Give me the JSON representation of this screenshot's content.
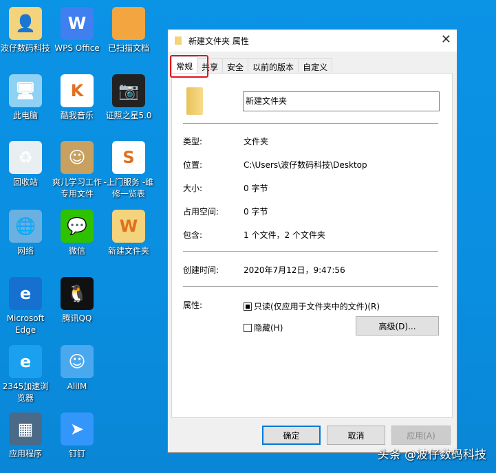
{
  "desktop": {
    "icons": [
      {
        "label": "波仔数码科技",
        "icon": "user-folder-icon",
        "color": "#f3d37b",
        "glyph": "👤"
      },
      {
        "label": "WPS Office",
        "icon": "wps-icon",
        "color": "#3f7ff0",
        "glyph": "W"
      },
      {
        "label": "已扫描文档",
        "icon": "folder-icon",
        "color": "#f3a640",
        "glyph": ""
      },
      {
        "label": "此电脑",
        "icon": "computer-icon",
        "color": "#8fd0f5",
        "glyph": "🖥"
      },
      {
        "label": "酷我音乐",
        "icon": "kuwo-icon",
        "color": "#ffffff",
        "glyph": "K"
      },
      {
        "label": "证照之星5.0",
        "icon": "camera-icon",
        "color": "#222222",
        "glyph": "📷"
      },
      {
        "label": "回收站",
        "icon": "recycle-bin-icon",
        "color": "#e8eef2",
        "glyph": "♻"
      },
      {
        "label": "爽儿学习工作专用文件",
        "icon": "photo-icon",
        "color": "#c8a060",
        "glyph": "☺"
      },
      {
        "label": "-上门服务 -维修一览表",
        "icon": "spreadsheet-icon",
        "color": "#ffffff",
        "glyph": "S"
      },
      {
        "label": "网络",
        "icon": "network-icon",
        "color": "#6ab0e0",
        "glyph": "🌐"
      },
      {
        "label": "微信",
        "icon": "wechat-icon",
        "color": "#2dc100",
        "glyph": "💬"
      },
      {
        "label": "新建文件夹",
        "icon": "folder-icon",
        "color": "#f3d37b",
        "glyph": "W"
      },
      {
        "label": "Microsoft Edge",
        "icon": "edge-icon",
        "color": "#1570d0",
        "glyph": "e"
      },
      {
        "label": "腾讯QQ",
        "icon": "qq-icon",
        "color": "#111111",
        "glyph": "🐧"
      },
      {
        "label": "",
        "icon": "",
        "color": "",
        "glyph": ""
      },
      {
        "label": "2345加速浏览器",
        "icon": "browser-icon",
        "color": "#1aa0ef",
        "glyph": "e"
      },
      {
        "label": "AliIM",
        "icon": "aliim-icon",
        "color": "#4aa8ef",
        "glyph": "☺"
      },
      {
        "label": "",
        "icon": "",
        "color": "",
        "glyph": ""
      },
      {
        "label": "应用程序",
        "icon": "apps-icon",
        "color": "#4a6a88",
        "glyph": "▦"
      },
      {
        "label": "钉钉",
        "icon": "dingtalk-icon",
        "color": "#3296fa",
        "glyph": "➤"
      }
    ]
  },
  "dialog": {
    "title": "新建文件夹 属性",
    "tabs": [
      "常规",
      "共享",
      "安全",
      "以前的版本",
      "自定义"
    ],
    "name": "新建文件夹",
    "fields": [
      {
        "label": "类型:",
        "value": "文件夹"
      },
      {
        "label": "位置:",
        "value": "C:\\Users\\波仔数码科技\\Desktop"
      },
      {
        "label": "大小:",
        "value": "0 字节"
      },
      {
        "label": "占用空间:",
        "value": "0 字节"
      },
      {
        "label": "包含:",
        "value": "1 个文件，2 个文件夹"
      }
    ],
    "created_label": "创建时间:",
    "created_value": "2020年7月12日，9:47:56",
    "attributes_label": "属性:",
    "readonly_label": "只读(仅应用于文件夹中的文件)(R)",
    "hidden_label": "隐藏(H)",
    "advanced_label": "高级(D)...",
    "ok_label": "确定",
    "cancel_label": "取消",
    "apply_label": "应用(A)"
  },
  "watermark": "头条 @波仔数码科技"
}
